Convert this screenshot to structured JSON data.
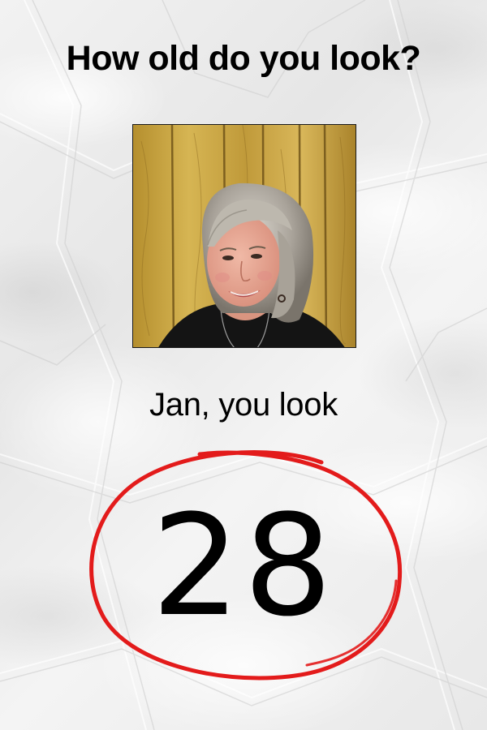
{
  "heading": {
    "title": "How old do you look?"
  },
  "photo": {
    "kind": "portrait photo"
  },
  "result": {
    "caption": "Jan, you look",
    "age": "28",
    "circle_color": "#e31b1b"
  }
}
